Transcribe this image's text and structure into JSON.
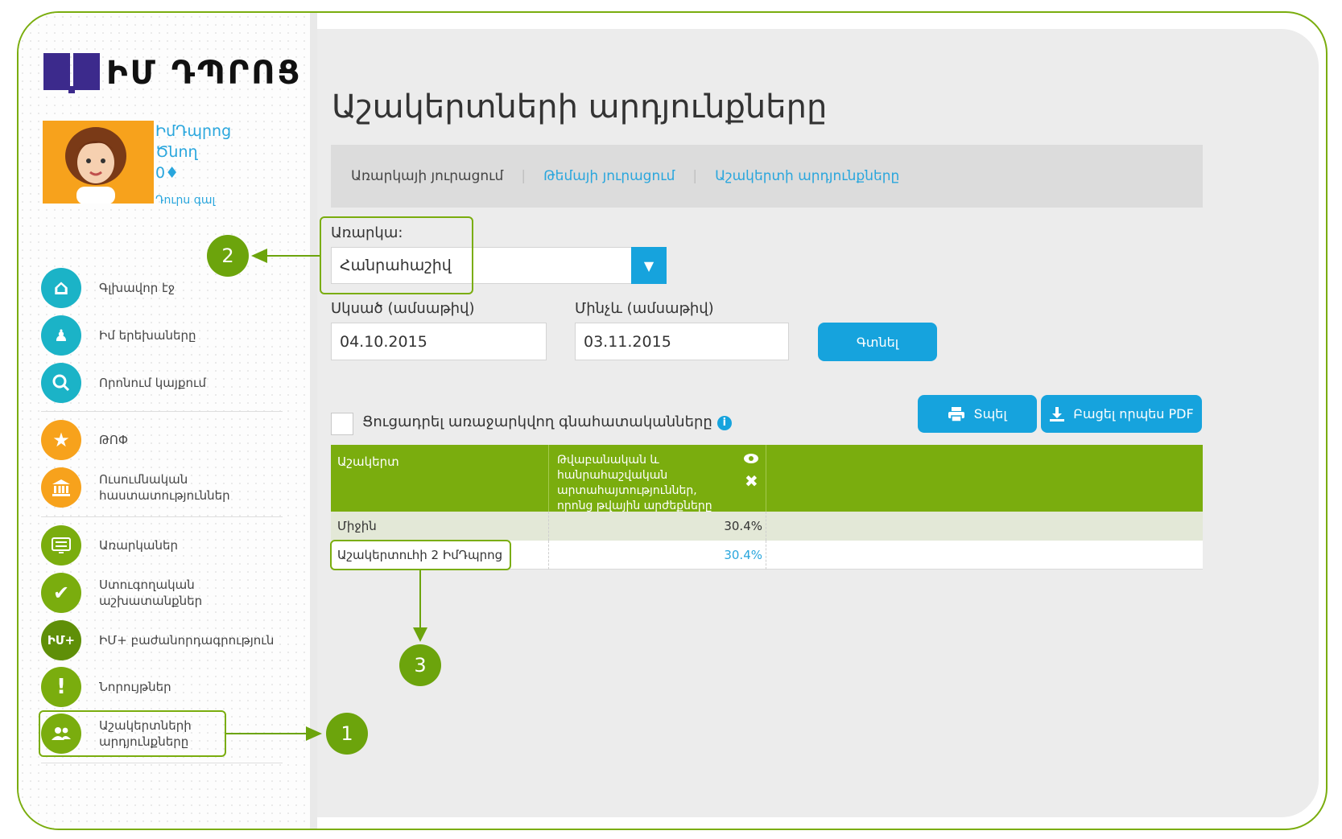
{
  "logo": {
    "text": "ԻՄ ԴՊՐՈՑ"
  },
  "user": {
    "first_name": "ԻմԴպրոց",
    "last_name": "Ծնող",
    "points": "0♦",
    "logout": "Դուրս գալ"
  },
  "nav": [
    {
      "label": "Գլխավոր էջ",
      "icon": "home-icon",
      "glyph": "⌂"
    },
    {
      "label": "Իմ երեխաները",
      "icon": "children-icon",
      "glyph": "👪"
    },
    {
      "label": "Որոնում կայքում",
      "icon": "search-icon",
      "glyph": "🔍"
    },
    {
      "label": "ԹՈՓ",
      "icon": "star-icon",
      "glyph": "★"
    },
    {
      "label_line1": "Ուսումնական",
      "label_line2": "հաստատություններ",
      "icon": "institution-icon",
      "glyph": "🏛"
    },
    {
      "label": "Առարկաներ",
      "icon": "subjects-icon",
      "glyph": "▤"
    },
    {
      "label_line1": "Ստուգողական",
      "label_line2": "աշխատանքներ",
      "icon": "check-icon",
      "glyph": "✔"
    },
    {
      "label": "ԻՄ+ բաժանորդագրություն",
      "icon": "im-plus-icon",
      "glyph": "ԻՄ+"
    },
    {
      "label": "Նորույթներ",
      "icon": "exclamation-icon",
      "glyph": "!"
    },
    {
      "label_line1": "Աշակերտների",
      "label_line2": "արդյունքները",
      "icon": "students-icon",
      "glyph": "👥"
    }
  ],
  "callouts": {
    "one": "1",
    "two": "2",
    "three": "3"
  },
  "page": {
    "title": "Աշակերտների արդյունքները"
  },
  "tabs": [
    {
      "label": "Առարկայի յուրացում"
    },
    {
      "label": "Թեմայի յուրացում"
    },
    {
      "label": "Աշակերտի արդյունքները"
    }
  ],
  "form": {
    "subject_label": "Առարկա:",
    "subject_value": "Հանրահաշիվ",
    "from_label": "Սկսած (ամսաթիվ)",
    "from_value": "04.10.2015",
    "to_label": "Մինչև (ամսաթիվ)",
    "to_value": "03.11.2015",
    "find_button": "Գտնել"
  },
  "actions": {
    "print": "Տպել",
    "pdf": "Բացել որպես PDF"
  },
  "toggle": {
    "label": "Ցուցադրել առաջարկվող գնահատականները"
  },
  "table": {
    "col1": "Աշակերտ",
    "col2_line1": "Թվաբանական և",
    "col2_line2": "հանրահաշվական",
    "col2_line3": "արտահայտություններ,",
    "col2_line4": "որոնց թվային արժեքները",
    "avg_label": "Միջին",
    "avg_value": "30.4%",
    "row_name": "Աշակերտուհի 2 ԻմԴպրոց",
    "row_value": "30.4%"
  },
  "colors": {
    "accent_green": "#7aad0e",
    "accent_blue": "#16a3dd",
    "link": "#29a6dd",
    "logo": "#3c2a8c"
  }
}
